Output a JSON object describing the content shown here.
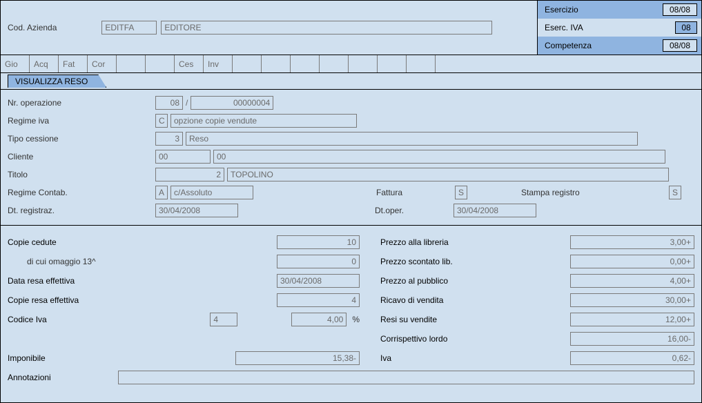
{
  "header": {
    "codAziendaLabel": "Cod. Azienda",
    "codAzienda": "EDITFA",
    "aziendaDesc": "EDITORE",
    "esercizioLabel": "Esercizio",
    "esercizioVal": "08/08",
    "esercIvaLabel": "Eserc. IVA",
    "esercIvaVal": "08",
    "competenzaLabel": "Competenza",
    "competenzaVal": "08/08"
  },
  "tabs": [
    "Gio",
    "Acq",
    "Fat",
    "Cor",
    "",
    "",
    "Ces",
    "Inv",
    "",
    "",
    "",
    "",
    "",
    "",
    "",
    ""
  ],
  "pageTab": "VISUALIZZA RESO",
  "form": {
    "nrOperazioneLabel": "Nr. operazione",
    "nrOpA": "08",
    "nrOpSep": "/",
    "nrOpB": "00000004",
    "regimeIvaLabel": "Regime iva",
    "regimeIvaCode": "C",
    "regimeIvaDesc": "opzione copie vendute",
    "tipoCessioneLabel": "Tipo cessione",
    "tipoCessioneCode": "3",
    "tipoCessioneDesc": "Reso",
    "clienteLabel": "Cliente",
    "clienteA": "00",
    "clienteB": "00",
    "titoloLabel": "Titolo",
    "titoloCode": "2",
    "titoloDesc": "TOPOLINO",
    "regimeContabLabel": "Regime Contab.",
    "regimeContabCode": "A",
    "regimeContabDesc": "c/Assoluto",
    "fatturaLabel": "Fattura",
    "fatturaVal": "S",
    "stampaRegistroLabel": "Stampa registro",
    "stampaRegistroVal": "S",
    "dtRegLabel": "Dt. registraz.",
    "dtRegVal": "30/04/2008",
    "dtOperLabel": "Dt.oper.",
    "dtOperVal": "30/04/2008"
  },
  "bottom": {
    "copieCeduteLabel": "Copie cedute",
    "copieCeduteVal": "10",
    "diCuiOmaggioLabel": "di cui omaggio 13^",
    "diCuiOmaggioVal": "0",
    "dataResaLabel": "Data resa effettiva",
    "dataResaVal": "30/04/2008",
    "copieResaLabel": "Copie resa effettiva",
    "copieResaVal": "4",
    "codiceIvaLabel": "Codice Iva",
    "codiceIvaCode": "4",
    "codiceIvaPct": "4,00",
    "pctSuffix": "%",
    "prezzoLibreriaLabel": "Prezzo alla libreria",
    "prezzoLibreriaVal": "3,00+",
    "prezzoScontatoLabel": "Prezzo scontato lib.",
    "prezzoScontatoVal": "0,00+",
    "prezzoPubblicoLabel": "Prezzo al pubblico",
    "prezzoPubblicoVal": "4,00+",
    "ricavoVenditaLabel": "Ricavo di vendita",
    "ricavoVenditaVal": "30,00+",
    "resiSuVenditeLabel": "Resi su vendite",
    "resiSuVenditeVal": "12,00+",
    "corrLordoLabel": "Corrispettivo lordo",
    "corrLordoVal": "16,00-",
    "imponibileLabel": "Imponibile",
    "imponibileVal": "15,38-",
    "ivaLabel": "Iva",
    "ivaVal": "0,62-",
    "annotazioniLabel": "Annotazioni",
    "annotazioniVal": ""
  }
}
